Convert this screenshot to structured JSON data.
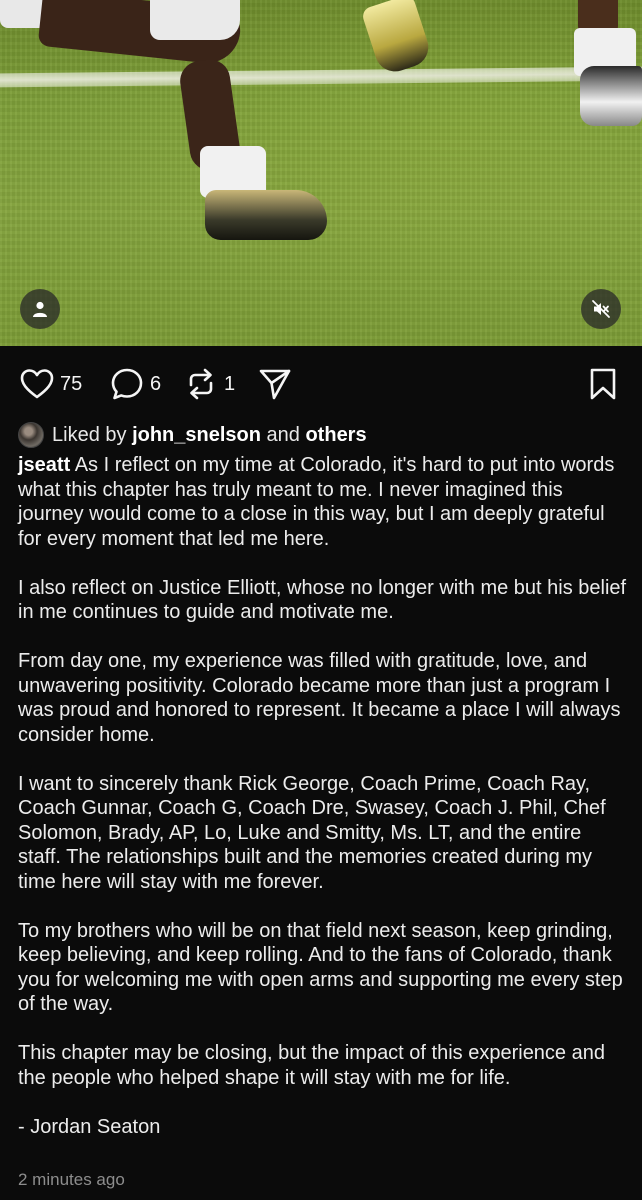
{
  "post": {
    "likes_count": "75",
    "comments_count": "6",
    "reposts_count": "1",
    "liked_by_prefix": "Liked by",
    "liked_by_user": "john_snelson",
    "liked_by_and": "and",
    "liked_by_others": "others",
    "author": "jseatt",
    "paragraphs": [
      "As I reflect on my time at Colorado, it's hard to put into words what this chapter has truly meant to me. I never imagined this journey would come to a close in this way, but I am deeply grateful for every moment that led me here.",
      "I also reflect on Justice Elliott, whose no longer with me but his belief in me continues to guide and motivate me.",
      "From day one, my experience was filled with gratitude, love, and unwavering positivity. Colorado became more than just a program I was proud and honored to represent. It became a place I will always consider home.",
      "I want to sincerely thank Rick George, Coach Prime, Coach Ray, Coach Gunnar, Coach G, Coach Dre, Swasey, Coach J. Phil, Chef Solomon, Brady, AP, Lo, Luke and Smitty, Ms. LT, and the entire staff. The relationships built and the memories created during my time here will stay with me forever.",
      "To my brothers who will be on that field next season, keep grinding, keep believing, and keep rolling. And to the fans of Colorado, thank you for welcoming me with open arms and supporting me every step of the way.",
      "This chapter may be closing, but the impact of this experience and the people who helped shape it will stay with me for life.",
      "- Jordan Seaton"
    ],
    "timestamp": "2 minutes ago"
  },
  "icons": {
    "media_user": "user-icon",
    "media_mute": "mute-icon",
    "like": "heart-icon",
    "comment": "comment-icon",
    "repost": "repost-icon",
    "share": "send-icon",
    "save": "bookmark-icon"
  },
  "colors": {
    "background": "#0b0b0b",
    "text": "#f2f2f2",
    "muted": "#8d8d8d"
  }
}
